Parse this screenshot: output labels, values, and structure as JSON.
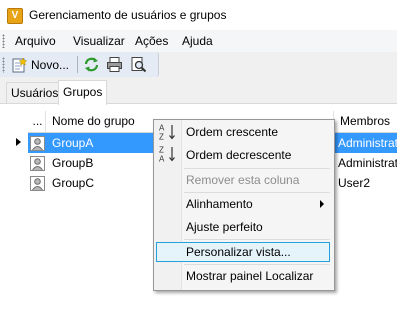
{
  "window": {
    "title": "Gerenciamento de usuários e grupos",
    "icon_letter": "V"
  },
  "menu": {
    "items": [
      "Arquivo",
      "Visualizar",
      "Ações",
      "Ajuda"
    ]
  },
  "toolbar": {
    "new_label": "Novo..."
  },
  "tabs": [
    "Usuários",
    "Grupos"
  ],
  "grid": {
    "headers": {
      "dots": "...",
      "name": "Nome do grupo",
      "members": "Membros"
    },
    "rows": [
      {
        "name": "GroupA",
        "members": "Administrat"
      },
      {
        "name": "GroupB",
        "members": "Administrat"
      },
      {
        "name": "GroupC",
        "members": "User2"
      }
    ]
  },
  "context_menu": {
    "sort_asc": "Ordem crescente",
    "sort_desc": "Ordem decrescente",
    "remove_column": "Remover esta coluna",
    "alignment": "Alinhamento",
    "best_fit": "Ajuste perfeito",
    "customize_view": "Personalizar vista...",
    "show_find_panel": "Mostrar painel Localizar"
  }
}
